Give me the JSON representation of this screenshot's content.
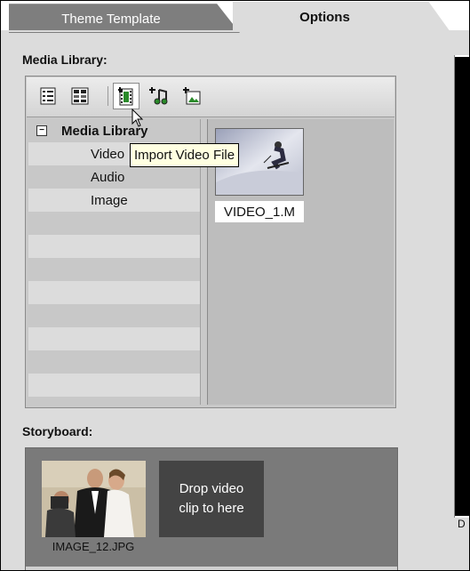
{
  "tabs": [
    {
      "label": "Theme Template",
      "active": false
    },
    {
      "label": "Options",
      "active": true
    }
  ],
  "media_library": {
    "section_label": "Media Library:",
    "toolbar": {
      "buttons": [
        {
          "name": "list-view-icon"
        },
        {
          "name": "thumbnail-view-icon"
        },
        {
          "name": "import-video-icon"
        },
        {
          "name": "import-audio-icon"
        },
        {
          "name": "import-image-icon"
        }
      ]
    },
    "tree": {
      "root": "Media Library",
      "expander": "−",
      "children": [
        "Video",
        "Audio",
        "Image"
      ]
    },
    "items": [
      {
        "caption": "VIDEO_1.M"
      }
    ],
    "tooltip": "Import Video File"
  },
  "storyboard": {
    "section_label": "Storyboard:",
    "clip_caption": "IMAGE_12.JPG",
    "drop_text": "Drop video clip to here"
  },
  "right_panel": {
    "label": "D"
  },
  "colors": {
    "tooltip_bg": "#ffffe1",
    "active_tab": "#dcdcdc",
    "inactive_tab": "#7e7e7e",
    "drop_zone": "#444444"
  }
}
